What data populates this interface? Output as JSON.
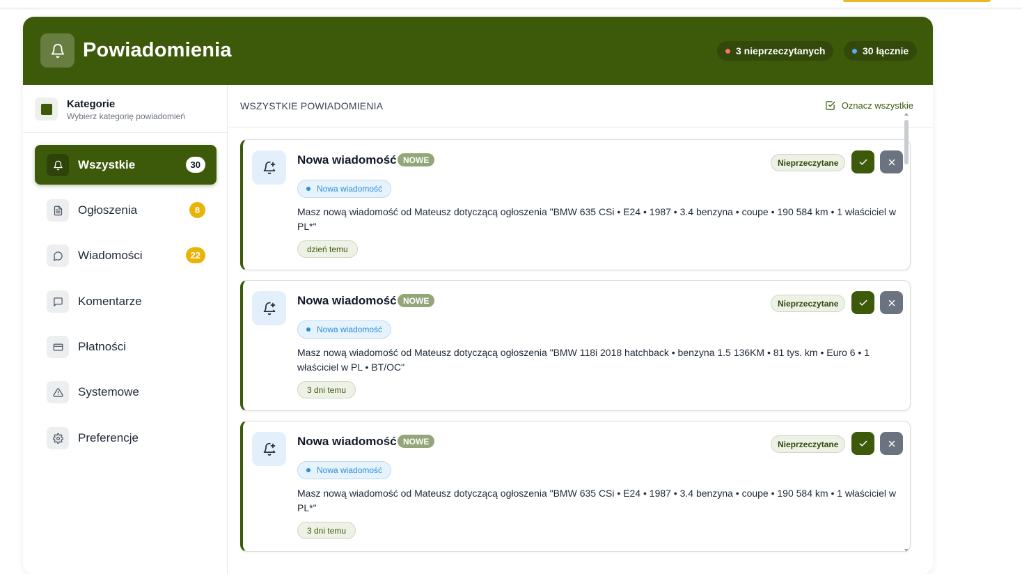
{
  "header": {
    "title": "Powiadomienia",
    "unread_label": "3 nieprzeczytanych",
    "total_label": "30 łącznie",
    "unread_dot_color": "#f87171",
    "total_dot_color": "#60a5fa",
    "icon": "bell-icon"
  },
  "sidebar": {
    "title": "Kategorie",
    "subtitle": "Wybierz kategorię powiadomień",
    "items": [
      {
        "label": "Wszystkie",
        "badge": "30",
        "icon": "bell-icon",
        "active": true
      },
      {
        "label": "Ogłoszenia",
        "badge": "8",
        "icon": "document-icon",
        "active": false
      },
      {
        "label": "Wiadomości",
        "badge": "22",
        "icon": "chat-bubble-icon",
        "active": false
      },
      {
        "label": "Komentarze",
        "badge": "",
        "icon": "comment-icon",
        "active": false
      },
      {
        "label": "Płatności",
        "badge": "",
        "icon": "credit-card-icon",
        "active": false
      },
      {
        "label": "Systemowe",
        "badge": "",
        "icon": "warning-icon",
        "active": false
      },
      {
        "label": "Preferencje",
        "badge": "",
        "icon": "gear-icon",
        "active": false
      }
    ]
  },
  "main": {
    "title": "WSZYSTKIE POWIADOMIENIA",
    "mark_all_label": "Oznacz wszystkie"
  },
  "notifications": [
    {
      "title": "Nowa wiadomość",
      "new_label": "NOWE",
      "type_label": "Nowa wiadomość",
      "text": "Masz nową wiadomość od Mateusz dotyczącą ogłoszenia \"BMW 635 CSi • E24 • 1987 • 3.4 benzyna • coupe • 190 584 km • 1 właściciel w PL*\"",
      "time": "dzień temu",
      "status": "Nieprzeczytane"
    },
    {
      "title": "Nowa wiadomość",
      "new_label": "NOWE",
      "type_label": "Nowa wiadomość",
      "text": "Masz nową wiadomość od Mateusz dotyczącą ogłoszenia \"BMW 118i 2018 hatchback • benzyna 1.5 136KM • 81 tys. km • Euro 6 • 1 właściciel w PL • BT/OC\"",
      "time": "3 dni temu",
      "status": "Nieprzeczytane"
    },
    {
      "title": "Nowa wiadomość",
      "new_label": "NOWE",
      "type_label": "Nowa wiadomość",
      "text": "Masz nową wiadomość od Mateusz dotyczącą ogłoszenia \"BMW 635 CSi • E24 • 1987 • 3.4 benzyna • coupe • 190 584 km • 1 właściciel w PL*\"",
      "time": "3 dni temu",
      "status": "Nieprzeczytane"
    }
  ],
  "colors": {
    "brand": "#3d5a0b",
    "badge_yellow": "#eab308",
    "info_blue": "#2b8fd6"
  }
}
